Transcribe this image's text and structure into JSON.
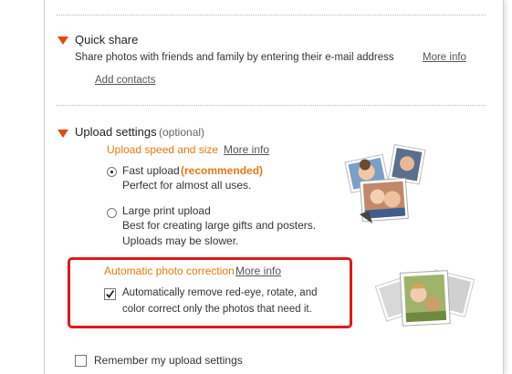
{
  "quick_share": {
    "title": "Quick share",
    "description": "Share photos with friends and family by entering their e-mail address",
    "more_info": "More info",
    "add_contacts": "Add contacts"
  },
  "upload_settings": {
    "title": "Upload settings",
    "optional": "(optional)",
    "speed_heading": "Upload speed and size",
    "speed_more_info": "More info",
    "fast_upload": {
      "label": "Fast upload",
      "badge": "(recommended)",
      "desc": "Perfect for almost all uses.",
      "selected": true
    },
    "large_upload": {
      "label": "Large print upload",
      "desc1": "Best for creating large gifts and posters.",
      "desc2": "Uploads may be slower.",
      "selected": false
    },
    "correction_heading": "Automatic photo correction",
    "correction_more_info": "More info",
    "correction_line1": "Automatically remove red-eye, rotate, and",
    "correction_line2": "color correct only the photos that need it.",
    "correction_checked": true,
    "remember_label": "Remember my upload settings",
    "remember_checked": false
  },
  "colors": {
    "accent": "#e57a0c",
    "arrow": "#e24a0c",
    "highlight": "#e01919"
  },
  "icons": {
    "photos_stack_1": "photo-stack-icon",
    "photos_stack_2": "photo-fan-icon"
  }
}
